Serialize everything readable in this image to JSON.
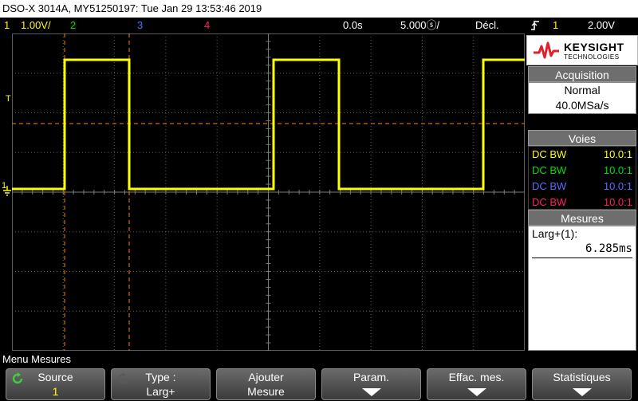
{
  "title_bar": "DSO-X 3014A, MY51250197: Tue Jan 29 13:53:46 2019",
  "top_bar": {
    "ch1_num": "1",
    "ch1_scale": "1.00V/",
    "ch2_num": "2",
    "ch3_num": "3",
    "ch4_num": "4",
    "time_delay": "0.0s",
    "time_scale": "5.000ⓢ/",
    "trigger_mode": "Décl.",
    "trigger_icon": "rising-edge-icon",
    "trigger_ch": "1",
    "trigger_level": "2.00V"
  },
  "screen": {
    "trigger_marker": "T",
    "ground_marker": "1",
    "waveform_color": "#ffff00",
    "cursor_color": "#ff8000",
    "grid_color": "#5a5a5a"
  },
  "panel": {
    "logo_brand": "KEYSIGHT",
    "logo_sub": "TECHNOLOGIES",
    "acq_header": "Acquisition",
    "acq_mode": "Normal",
    "acq_rate": "40.0MSa/s",
    "voies_header": "Voies",
    "channels": [
      {
        "coupling": "DC BW",
        "probe": "10.0:1",
        "color": "#ffff00"
      },
      {
        "coupling": "DC BW",
        "probe": "10.0:1",
        "color": "#00e000"
      },
      {
        "coupling": "DC BW",
        "probe": "10.0:1",
        "color": "#5a6cff"
      },
      {
        "coupling": "DC BW",
        "probe": "10.0:1",
        "color": "#ff2060"
      }
    ],
    "mes_header": "Mesures",
    "meas_label": "Larg+(1):",
    "meas_value": "6.285ms"
  },
  "menu_title": "Menu Mesures",
  "softkeys": [
    {
      "l1": "Source",
      "l2": "1"
    },
    {
      "l1": "Type :",
      "l2": "Larg+"
    },
    {
      "l1": "Ajouter",
      "l2": "Mesure"
    },
    {
      "l1": "Param.",
      "l2": ""
    },
    {
      "l1": "Effac. mes.",
      "l2": ""
    },
    {
      "l1": "Statistiques",
      "l2": ""
    }
  ]
}
